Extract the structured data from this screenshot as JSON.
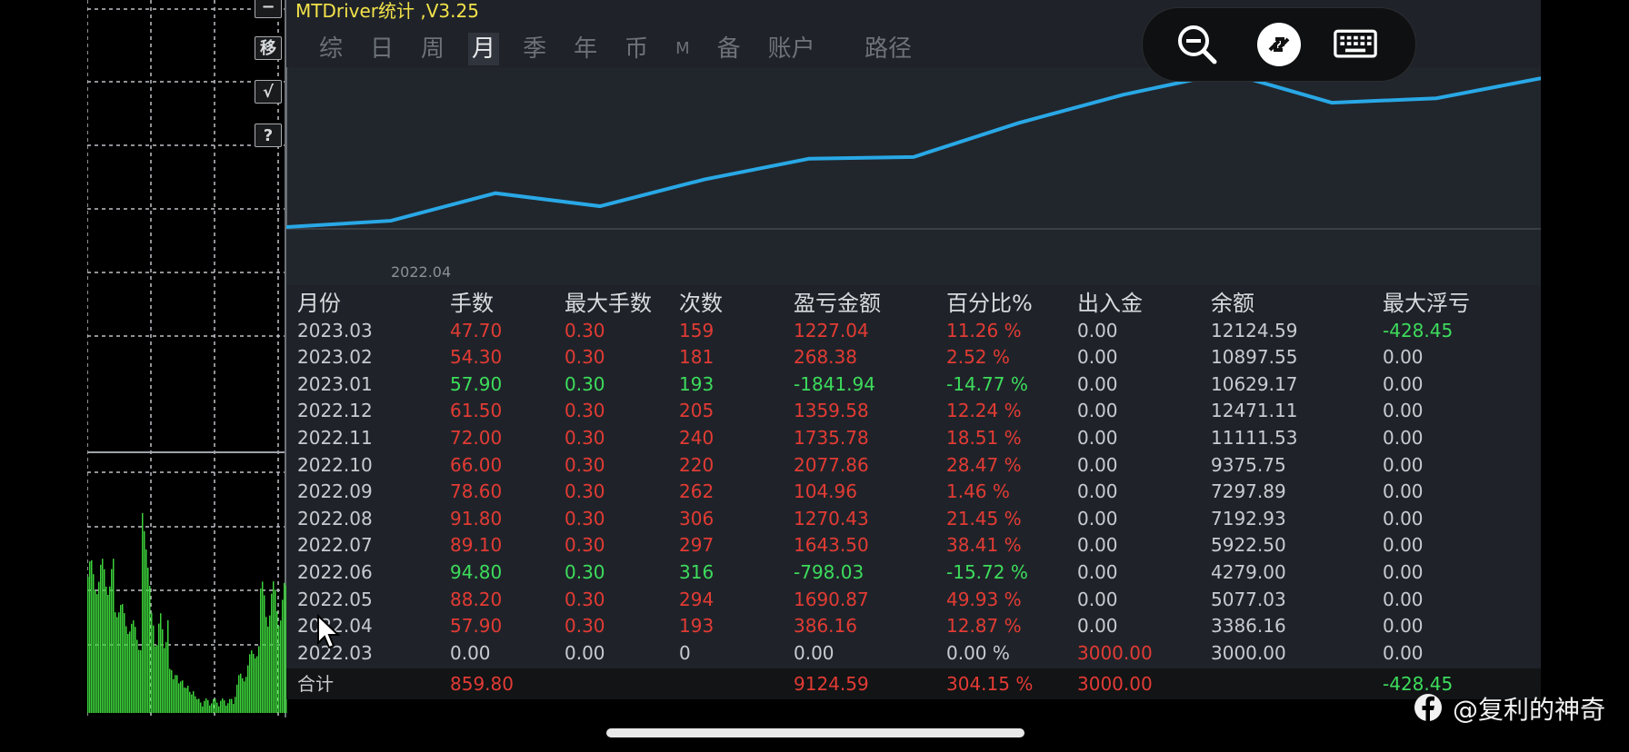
{
  "app": {
    "title": "MTDriver统计 ,V3.25"
  },
  "toolbar_buttons": [
    {
      "label": "−"
    },
    {
      "label": "移"
    },
    {
      "label": "√"
    },
    {
      "label": "?"
    }
  ],
  "tabs": [
    {
      "label": "综",
      "active": false
    },
    {
      "label": "日",
      "active": false
    },
    {
      "label": "周",
      "active": false
    },
    {
      "label": "月",
      "active": true
    },
    {
      "label": "季",
      "active": false
    },
    {
      "label": "年",
      "active": false
    },
    {
      "label": "币",
      "active": false
    },
    {
      "label": "M",
      "active": false
    },
    {
      "label": "备",
      "active": false
    },
    {
      "label": "账户",
      "active": false
    }
  ],
  "path_tab": "路径",
  "chart_data": {
    "type": "line",
    "x": [
      "2022.03",
      "2022.04",
      "2022.05",
      "2022.06",
      "2022.07",
      "2022.08",
      "2022.09",
      "2022.10",
      "2022.11",
      "2022.12",
      "2023.01",
      "2023.02",
      "2023.03"
    ],
    "values": [
      3000.0,
      3386.16,
      5077.03,
      4279.0,
      5922.5,
      7192.93,
      7297.89,
      9375.75,
      11111.53,
      12471.11,
      10629.17,
      10897.55,
      12124.59
    ],
    "x_tick_labels": [
      "2022.04"
    ],
    "color": "#29a8e6"
  },
  "table": {
    "headers": [
      "月份",
      "手数",
      "最大手数",
      "次数",
      "盈亏金额",
      "百分比%",
      "出入金",
      "余额",
      "最大浮亏"
    ],
    "rows": [
      {
        "cells": [
          "2023.03",
          "47.70",
          "0.30",
          "159",
          "1227.04",
          "11.26 %",
          "0.00",
          "12124.59",
          "-428.45"
        ],
        "tone": "red",
        "float_tone": "green"
      },
      {
        "cells": [
          "2023.02",
          "54.30",
          "0.30",
          "181",
          "268.38",
          "2.52 %",
          "0.00",
          "10897.55",
          "0.00"
        ],
        "tone": "red",
        "float_tone": "gray"
      },
      {
        "cells": [
          "2023.01",
          "57.90",
          "0.30",
          "193",
          "-1841.94",
          "-14.77 %",
          "0.00",
          "10629.17",
          "0.00"
        ],
        "tone": "green",
        "float_tone": "gray"
      },
      {
        "cells": [
          "2022.12",
          "61.50",
          "0.30",
          "205",
          "1359.58",
          "12.24 %",
          "0.00",
          "12471.11",
          "0.00"
        ],
        "tone": "red",
        "float_tone": "gray"
      },
      {
        "cells": [
          "2022.11",
          "72.00",
          "0.30",
          "240",
          "1735.78",
          "18.51 %",
          "0.00",
          "11111.53",
          "0.00"
        ],
        "tone": "red",
        "float_tone": "gray"
      },
      {
        "cells": [
          "2022.10",
          "66.00",
          "0.30",
          "220",
          "2077.86",
          "28.47 %",
          "0.00",
          "9375.75",
          "0.00"
        ],
        "tone": "red",
        "float_tone": "gray"
      },
      {
        "cells": [
          "2022.09",
          "78.60",
          "0.30",
          "262",
          "104.96",
          "1.46 %",
          "0.00",
          "7297.89",
          "0.00"
        ],
        "tone": "red",
        "float_tone": "gray"
      },
      {
        "cells": [
          "2022.08",
          "91.80",
          "0.30",
          "306",
          "1270.43",
          "21.45 %",
          "0.00",
          "7192.93",
          "0.00"
        ],
        "tone": "red",
        "float_tone": "gray"
      },
      {
        "cells": [
          "2022.07",
          "89.10",
          "0.30",
          "297",
          "1643.50",
          "38.41 %",
          "0.00",
          "5922.50",
          "0.00"
        ],
        "tone": "red",
        "float_tone": "gray"
      },
      {
        "cells": [
          "2022.06",
          "94.80",
          "0.30",
          "316",
          "-798.03",
          "-15.72 %",
          "0.00",
          "4279.00",
          "0.00"
        ],
        "tone": "green",
        "float_tone": "gray"
      },
      {
        "cells": [
          "2022.05",
          "88.20",
          "0.30",
          "294",
          "1690.87",
          "49.93 %",
          "0.00",
          "5077.03",
          "0.00"
        ],
        "tone": "red",
        "float_tone": "gray"
      },
      {
        "cells": [
          "2022.04",
          "57.90",
          "0.30",
          "193",
          "386.16",
          "12.87 %",
          "0.00",
          "3386.16",
          "0.00"
        ],
        "tone": "red",
        "float_tone": "gray"
      },
      {
        "cells": [
          "2022.03",
          "0.00",
          "0.00",
          "0",
          "0.00",
          "0.00 %",
          "3000.00",
          "3000.00",
          "0.00"
        ],
        "tone": "gray",
        "float_tone": "gray",
        "deposit_tone": "red"
      }
    ],
    "total": {
      "cells": [
        "合计",
        "859.80",
        "",
        "",
        "9124.59",
        "304.15 %",
        "3000.00",
        "",
        "-428.45"
      ]
    }
  },
  "remote_toolbar": {
    "icons": [
      "zoom-out-icon",
      "remote-desktop-icon",
      "keyboard-icon"
    ]
  },
  "watermark": {
    "text": "@复利的神奇"
  },
  "colors": {
    "profit": "#e23b34",
    "loss": "#3ddc5c",
    "title": "#f3e24a",
    "equity_line": "#29a8e6"
  }
}
